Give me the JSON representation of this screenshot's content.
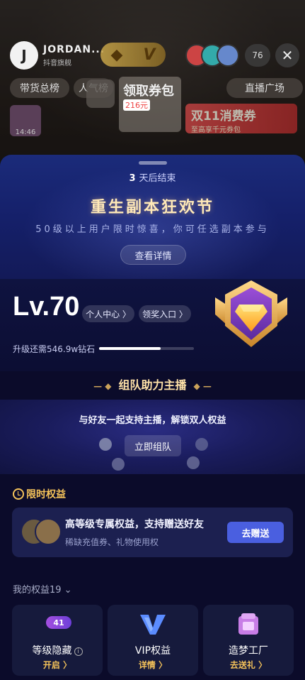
{
  "background": {
    "brand_name": "JORDAN...",
    "brand_subtitle": "抖音旗舰",
    "brand_logo_letter": "J",
    "viewer_count": "76",
    "chips": [
      "带货总榜",
      "人气榜",
      "直播广场"
    ],
    "promo_coupon_label": "领取券包",
    "promo_coupon_value": "216元",
    "promo_banner_title": "双11消费券",
    "promo_banner_sub": "至高享千元券包",
    "thumb_time": "14:46"
  },
  "sheet": {
    "countdown_num": "3",
    "countdown_text": "天后结束",
    "event_title": "重生副本狂欢节",
    "event_subtitle": "50级以上用户限时惊喜，你可任选副本参与",
    "detail_button": "查看详情",
    "level": "Lv.70",
    "personal_center": "个人中心 〉",
    "reward_entry": "领奖入口 〉",
    "upgrade_need": "升级还需546.9w钻石",
    "upgrade_progress": 0.65,
    "team_title": "组队助力主播",
    "team_desc": "与好友一起支持主播，解锁双人权益",
    "team_button": "立即组队",
    "limited_title": "限时权益",
    "limited_card_title": "高等级专属权益，支持赠送好友",
    "limited_card_sub": "稀缺充值券、礼物使用权",
    "limited_card_button": "去赠送",
    "my_benefits_title": "我的权益19",
    "benefits": [
      {
        "label": "等级隐藏",
        "action": "开启 〉",
        "badge": "41"
      },
      {
        "label": "VIP权益",
        "action": "详情 〉"
      },
      {
        "label": "造梦工厂",
        "action": "去送礼 〉"
      }
    ]
  },
  "colors": {
    "accent_gold": "#f5c35a",
    "button_blue": "#4a5fe0",
    "sheet_bg": "#0b0b2a"
  }
}
